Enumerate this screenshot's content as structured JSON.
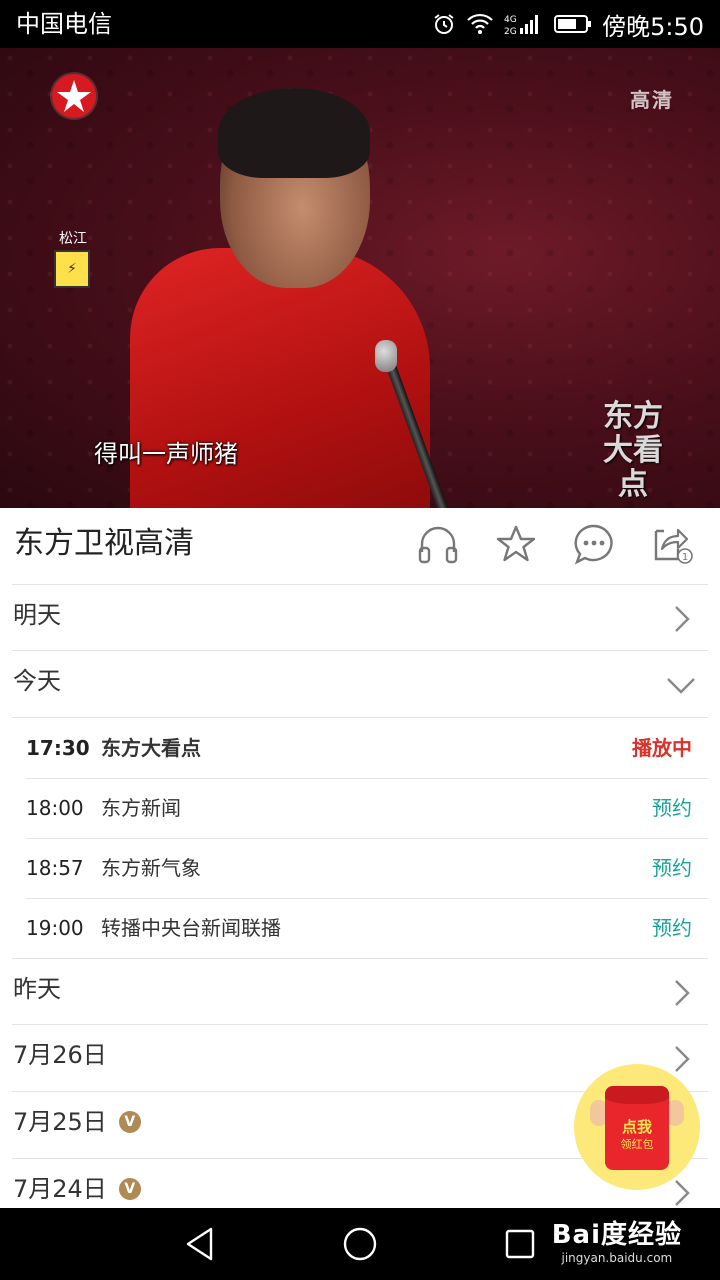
{
  "status_bar": {
    "carrier": "中国电信",
    "signal_label": "4G 2G",
    "time": "傍晚5:50"
  },
  "video": {
    "subtitle": "得叫一声师猪",
    "hd_mark": "高清",
    "watermark": "东方大看点",
    "corner_logo_text": "松江"
  },
  "channel": {
    "title": "东方卫视高清",
    "actions": [
      {
        "name": "audio",
        "icon": "headphones-icon"
      },
      {
        "name": "favorite",
        "icon": "star-icon"
      },
      {
        "name": "comment",
        "icon": "chat-bubble-icon"
      },
      {
        "name": "share",
        "icon": "share-icon",
        "badge": "1"
      }
    ]
  },
  "days_top": [
    {
      "label": "明天",
      "expanded": false
    },
    {
      "label": "今天",
      "expanded": true
    }
  ],
  "today_programs": [
    {
      "time": "17:30",
      "name": "东方大看点",
      "status": "播放中",
      "live": true
    },
    {
      "time": "18:00",
      "name": "东方新闻",
      "status": "预约",
      "live": false
    },
    {
      "time": "18:57",
      "name": "东方新气象",
      "status": "预约",
      "live": false
    },
    {
      "time": "19:00",
      "name": "转播中央台新闻联播",
      "status": "预约",
      "live": false
    }
  ],
  "days_bottom": [
    {
      "label": "昨天",
      "vip": false
    },
    {
      "label": "7月26日",
      "vip": false
    },
    {
      "label": "7月25日",
      "vip": true
    },
    {
      "label": "7月24日",
      "vip": true
    }
  ],
  "vip_badge": "V",
  "red_envelope": {
    "line1": "点我",
    "line2": "领红包"
  },
  "watermark_site": {
    "brand": "Bai度经验",
    "url": "jingyan.baidu.com"
  },
  "colors": {
    "live": "#d9342b",
    "reserve": "#1aa39a",
    "divider": "#e2e2e2"
  }
}
